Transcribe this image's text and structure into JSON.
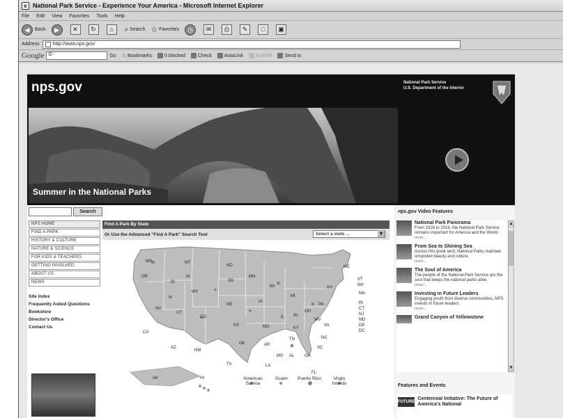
{
  "window": {
    "title": "National Park Service - Experience Your America - Microsoft Internet Explorer"
  },
  "menu": [
    "File",
    "Edit",
    "View",
    "Favorites",
    "Tools",
    "Help"
  ],
  "toolbar": {
    "back": "Back",
    "search": "Search",
    "favorites": "Favorites"
  },
  "address": {
    "label": "Address",
    "url": "http://www.nps.gov/"
  },
  "google_bar": {
    "logo": "Google",
    "search_value": "G-",
    "go": "Go",
    "bookmarks": "Bookmarks",
    "blocked": "0 blocked",
    "check": "Check",
    "autolink": "AutoLink",
    "autofill": "AutoFill",
    "sendto": "Send to"
  },
  "site": {
    "logo": "nps.gov",
    "agency_line1": "National Park Service",
    "agency_line2": "U.S. Department of the Interior",
    "hero_caption": "Summer in the National Parks",
    "search_button": "Search",
    "nav": [
      "NPS HOME",
      "FIND A PARK",
      "HISTORY & CULTURE",
      "NATURE & SCIENCE",
      "FOR KIDS & TEACHERS",
      "GETTING INVOLVED",
      "ABOUT US",
      "NEWS"
    ],
    "links": [
      "Site Index",
      "Frequently Asked Questions",
      "Bookstore",
      "Director's Office",
      "Contact Us"
    ]
  },
  "find_park": {
    "header": "Find A Park By State",
    "subheader": "Or Use the Advanced \"Find A Park\" Search Tool",
    "select_placeholder": "Select a state ...",
    "states": [
      "WA",
      "MT",
      "ND",
      "MN",
      "OR",
      "ID",
      "SD",
      "WI",
      "MI",
      "NY",
      "ME",
      "VT",
      "NH",
      "MA",
      "RI",
      "CT",
      "NJ",
      "WY",
      "NE",
      "IA",
      "PA",
      "OH",
      "IN",
      "IL",
      "NV",
      "UT",
      "CO",
      "KS",
      "MO",
      "KY",
      "WV",
      "VA",
      "MD",
      "DE",
      "DC",
      "CA",
      "TN",
      "NC",
      "AZ",
      "NM",
      "OK",
      "AR",
      "SC",
      "MS",
      "AL",
      "GA",
      "TX",
      "LA",
      "FL",
      "AK",
      "HI"
    ],
    "territories": [
      "American Samoa",
      "Guam",
      "Puerto Rico",
      "Virgin Islands"
    ]
  },
  "videos": {
    "title": "nps.gov Video Features",
    "items": [
      {
        "title": "National Park Panorama",
        "desc": "From 1916 to 2016, the National Park Service remains important for America and the World.",
        "more": "more..."
      },
      {
        "title": "From Sea to Shining Sea",
        "desc": "Across this great land, National Parks maintain unspoiled beauty and culture.",
        "more": "more..."
      },
      {
        "title": "The Soul of America",
        "desc": "The people of the National Park Service are the soul that keeps the national parks alive.",
        "more": "more..."
      },
      {
        "title": "Investing in Future Leaders",
        "desc": "Engaging youth from diverse communities, NPS invests in future leaders.",
        "more": "more..."
      },
      {
        "title": "Grand Canyon of Yellowstone",
        "desc": "",
        "more": ""
      }
    ]
  },
  "features": {
    "title": "Features and Events",
    "logo": "FUTURE",
    "item": "Centennial Initiative: The Future of America's National"
  }
}
